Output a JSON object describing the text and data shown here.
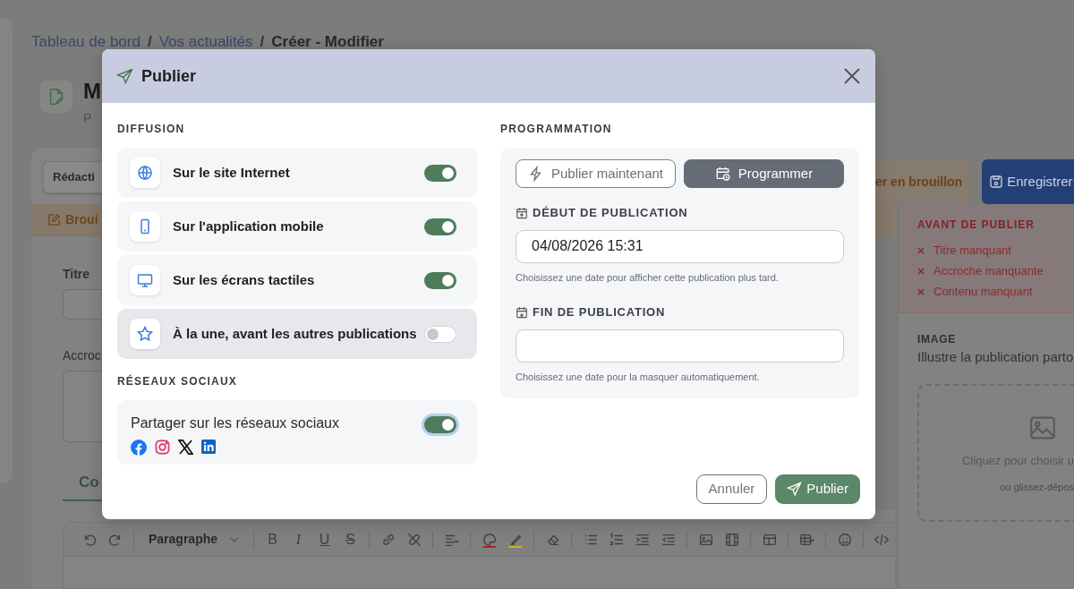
{
  "breadcrumb": [
    {
      "label": "Tableau de bord",
      "kind": "link"
    },
    {
      "label": "Vos actualités",
      "kind": "link",
      "separator": "/"
    },
    {
      "label": "Créer - Modifier",
      "kind": "current",
      "separator": "/"
    }
  ],
  "page": {
    "title": "M",
    "subtitle": "P",
    "tab": "Rédacti",
    "status": "Broui",
    "title_label": "Titre",
    "teaser_label": "Accroc",
    "content_tab": "Co",
    "draft_button": "er en brouillon",
    "save_button": "Enregistrer"
  },
  "checklist": {
    "title": "AVANT DE PUBLIER",
    "items": [
      "Titre manquant",
      "Accroche manquante",
      "Contenu manquant"
    ]
  },
  "image_panel": {
    "title": "IMAGE",
    "description": "Illustre la publication parto",
    "drop_text": "Cliquez pour choisir u",
    "drop_hint": "ou glissez-dépos"
  },
  "editor_toolbar": {
    "block_format": "Paragraphe",
    "glyphs": [
      "B",
      "I",
      "U",
      "S"
    ]
  },
  "modal": {
    "title": "Publier",
    "diffusion": {
      "heading": "DIFFUSION",
      "channels": [
        {
          "label": "Sur le site Internet",
          "kind": "globe",
          "on": true,
          "hovered": false
        },
        {
          "label": "Sur l'application mobile",
          "kind": "phone",
          "on": true,
          "hovered": false
        },
        {
          "label": "Sur les écrans tactiles",
          "kind": "monitor",
          "on": true,
          "hovered": false
        },
        {
          "label": "À la une, avant les autres publications",
          "kind": "star",
          "on": false,
          "hovered": true
        }
      ]
    },
    "social": {
      "heading": "RÉSEAUX SOCIAUX",
      "label": "Partager sur les réseaux sociaux",
      "on": true,
      "focused": true
    },
    "schedule": {
      "heading": "PROGRAMMATION",
      "modes": [
        {
          "label": "Publier maintenant",
          "kind": "now",
          "selected": false
        },
        {
          "label": "Programmer",
          "kind": "schedule",
          "selected": true
        }
      ],
      "fields": [
        {
          "label": "DÉBUT DE PUBLICATION",
          "kind": "start",
          "value": "04/08/2026 15:31",
          "help": "Choisissez une date pour afficher cette publication plus tard."
        },
        {
          "label": "FIN DE PUBLICATION",
          "kind": "end",
          "help": "Choisissez une date pour la masquer automatiquement."
        }
      ]
    },
    "cancel": "Annuler",
    "submit": "Publier"
  }
}
